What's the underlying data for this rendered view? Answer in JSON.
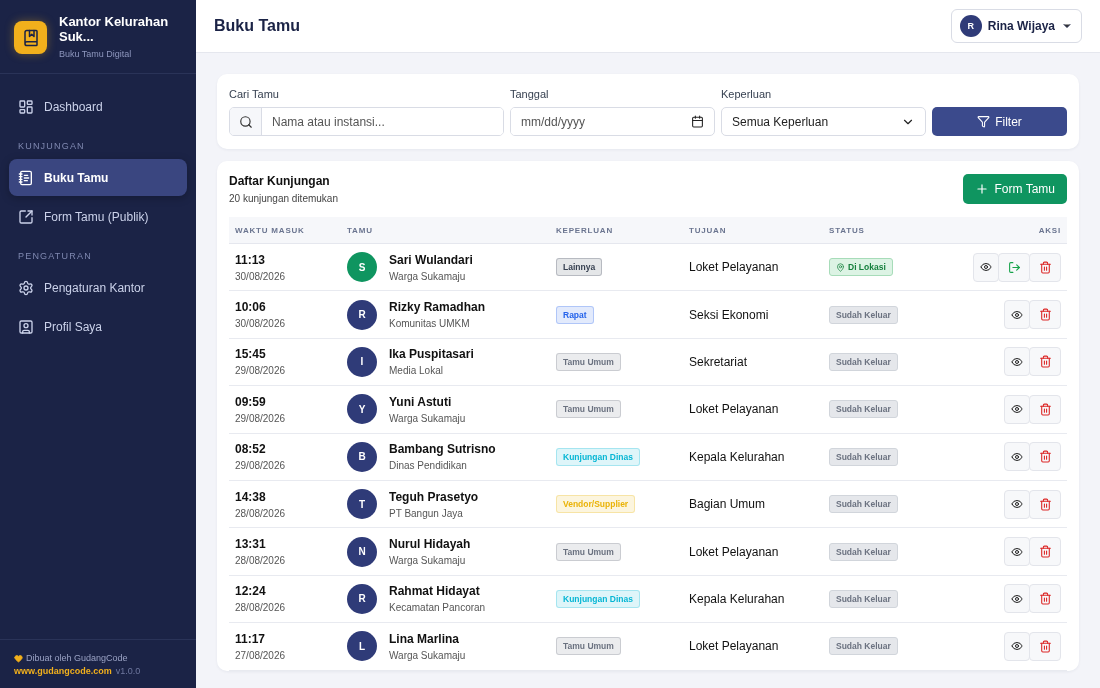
{
  "sidebar": {
    "brand": {
      "name": "Kantor Kelurahan Suk...",
      "subtitle": "Buku Tamu Digital"
    },
    "groups": [
      {
        "items": [
          {
            "label": "Dashboard",
            "selected": false
          }
        ]
      },
      {
        "heading": "KUNJUNGAN",
        "items": [
          {
            "label": "Buku Tamu",
            "selected": true
          },
          {
            "label": "Form Tamu (Publik)",
            "selected": false
          }
        ]
      },
      {
        "heading": "PENGATURAN",
        "items": [
          {
            "label": "Pengaturan Kantor",
            "selected": false
          },
          {
            "label": "Profil Saya",
            "selected": false
          }
        ]
      }
    ],
    "footer": {
      "credit": "Dibuat oleh GudangCode",
      "link": "www.gudangcode.com",
      "version": "v1.0.0"
    }
  },
  "header": {
    "title": "Buku Tamu",
    "user": {
      "initial": "R",
      "name": "Rina Wijaya"
    }
  },
  "filters": {
    "search": {
      "label": "Cari Tamu",
      "placeholder": "Nama atau instansi..."
    },
    "date": {
      "label": "Tanggal",
      "placeholder": "mm/dd/yyyy"
    },
    "purpose": {
      "label": "Keperluan",
      "value": "Semua Keperluan"
    },
    "button": "Filter"
  },
  "list": {
    "title": "Daftar Kunjungan",
    "count": "20 kunjungan ditemukan",
    "add_button": "Form Tamu",
    "columns": [
      "WAKTU MASUK",
      "TAMU",
      "KEPERLUAN",
      "TUJUAN",
      "STATUS",
      "AKSI"
    ],
    "rows": [
      {
        "time": "11:13",
        "date": "30/08/2026",
        "initial": "S",
        "name": "Sari Wulandari",
        "org": "Warga Sukamaju",
        "purpose": {
          "label": "Lainnya",
          "color": "#374151"
        },
        "destination": "Loket Pelayanan",
        "status": {
          "kind": "onsite",
          "label": "Di Lokasi"
        }
      },
      {
        "time": "10:06",
        "date": "30/08/2026",
        "initial": "R",
        "name": "Rizky Ramadhan",
        "org": "Komunitas UMKM",
        "purpose": {
          "label": "Rapat",
          "color": "#2563eb"
        },
        "destination": "Seksi Ekonomi",
        "status": {
          "kind": "left",
          "label": "Sudah Keluar"
        }
      },
      {
        "time": "15:45",
        "date": "29/08/2026",
        "initial": "I",
        "name": "Ika Puspitasari",
        "org": "Media Lokal",
        "purpose": {
          "label": "Tamu Umum",
          "color": "#6b7280"
        },
        "destination": "Sekretariat",
        "status": {
          "kind": "left",
          "label": "Sudah Keluar"
        }
      },
      {
        "time": "09:59",
        "date": "29/08/2026",
        "initial": "Y",
        "name": "Yuni Astuti",
        "org": "Warga Sukamaju",
        "purpose": {
          "label": "Tamu Umum",
          "color": "#6b7280"
        },
        "destination": "Loket Pelayanan",
        "status": {
          "kind": "left",
          "label": "Sudah Keluar"
        }
      },
      {
        "time": "08:52",
        "date": "29/08/2026",
        "initial": "B",
        "name": "Bambang Sutrisno",
        "org": "Dinas Pendidikan",
        "purpose": {
          "label": "Kunjungan Dinas",
          "color": "#06b6d4"
        },
        "destination": "Kepala Kelurahan",
        "status": {
          "kind": "left",
          "label": "Sudah Keluar"
        }
      },
      {
        "time": "14:38",
        "date": "28/08/2026",
        "initial": "T",
        "name": "Teguh Prasetyo",
        "org": "PT Bangun Jaya",
        "purpose": {
          "label": "Vendor/Supplier",
          "color": "#eab308"
        },
        "destination": "Bagian Umum",
        "status": {
          "kind": "left",
          "label": "Sudah Keluar"
        }
      },
      {
        "time": "13:31",
        "date": "28/08/2026",
        "initial": "N",
        "name": "Nurul Hidayah",
        "org": "Warga Sukamaju",
        "purpose": {
          "label": "Tamu Umum",
          "color": "#6b7280"
        },
        "destination": "Loket Pelayanan",
        "status": {
          "kind": "left",
          "label": "Sudah Keluar"
        }
      },
      {
        "time": "12:24",
        "date": "28/08/2026",
        "initial": "R",
        "name": "Rahmat Hidayat",
        "org": "Kecamatan Pancoran",
        "purpose": {
          "label": "Kunjungan Dinas",
          "color": "#06b6d4"
        },
        "destination": "Kepala Kelurahan",
        "status": {
          "kind": "left",
          "label": "Sudah Keluar"
        }
      },
      {
        "time": "11:17",
        "date": "27/08/2026",
        "initial": "L",
        "name": "Lina Marlina",
        "org": "Warga Sukamaju",
        "purpose": {
          "label": "Tamu Umum",
          "color": "#6b7280"
        },
        "destination": "Loket Pelayanan",
        "status": {
          "kind": "left",
          "label": "Sudah Keluar"
        }
      }
    ]
  }
}
